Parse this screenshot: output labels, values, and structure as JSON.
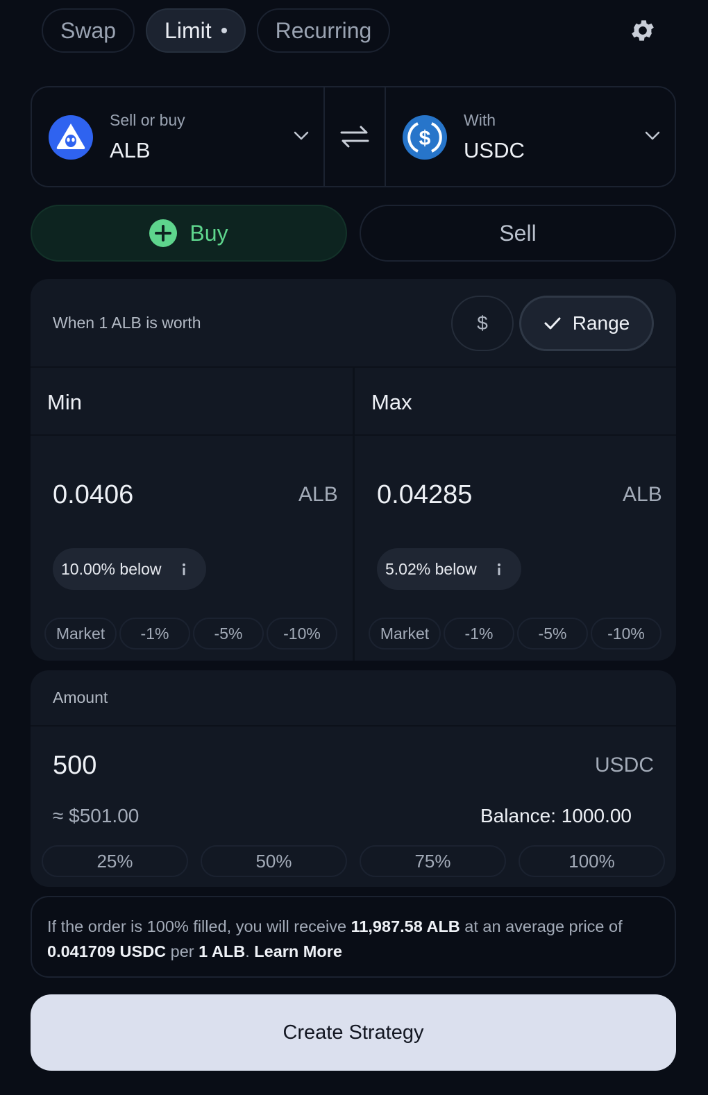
{
  "tabs": [
    {
      "label": "Swap"
    },
    {
      "label": "Limit"
    },
    {
      "label": "Recurring"
    }
  ],
  "pair": {
    "sell": {
      "label": "Sell or buy",
      "token": "ALB"
    },
    "with": {
      "label": "With",
      "token": "USDC"
    }
  },
  "side": {
    "buy_label": "Buy",
    "sell_label": "Sell",
    "selected": "Buy"
  },
  "price": {
    "label": "When 1 ALB is worth",
    "dollar_label": "$",
    "range_label": "Range",
    "min": {
      "header": "Min",
      "value": "0.0406",
      "unit": "ALB",
      "pct": "10.00% below",
      "quick": [
        "Market",
        "-1%",
        "-5%",
        "-10%"
      ]
    },
    "max": {
      "header": "Max",
      "value": "0.04285",
      "unit": "ALB",
      "pct": "5.02% below",
      "quick": [
        "Market",
        "-1%",
        "-5%",
        "-10%"
      ]
    }
  },
  "amount": {
    "label": "Amount",
    "value": "500",
    "unit": "USDC",
    "usd": "≈ $501.00",
    "balance": "Balance: 1000.00",
    "quick": [
      "25%",
      "50%",
      "75%",
      "100%"
    ]
  },
  "info": {
    "t1": "If the order is 100% filled, you will receive ",
    "b1": "11,987.58 ALB",
    "t2": " at an average price of ",
    "b2": "0.041709 USDC",
    "t3": " per ",
    "b3": "1 ALB",
    "t4": ". ",
    "link": "Learn More"
  },
  "create_label": "Create Strategy",
  "colors": {
    "background": "#090d16",
    "card": "#121823",
    "buy_accent": "#5ed58d",
    "alb_brand": "#2f63f0",
    "usdc_brand": "#2775ca",
    "primary_button": "#dbe0ee"
  },
  "icons": {
    "settings": "gear-icon",
    "swap": "swap-arrows-icon",
    "dropdown": "chevron-down-icon",
    "buy": "plus-circle-icon",
    "range": "check-icon",
    "pct_info": "info-icon"
  }
}
